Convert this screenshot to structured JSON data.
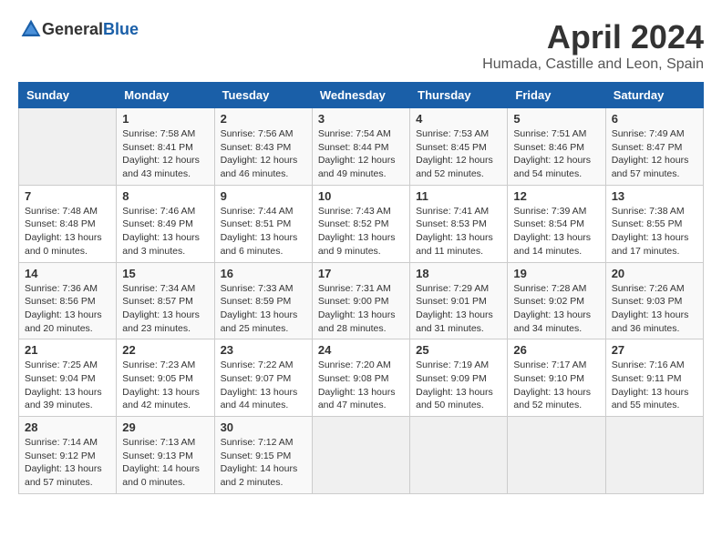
{
  "header": {
    "logo_general": "General",
    "logo_blue": "Blue",
    "title": "April 2024",
    "subtitle": "Humada, Castille and Leon, Spain"
  },
  "calendar": {
    "days_of_week": [
      "Sunday",
      "Monday",
      "Tuesday",
      "Wednesday",
      "Thursday",
      "Friday",
      "Saturday"
    ],
    "weeks": [
      [
        {
          "day": "",
          "info": ""
        },
        {
          "day": "1",
          "info": "Sunrise: 7:58 AM\nSunset: 8:41 PM\nDaylight: 12 hours\nand 43 minutes."
        },
        {
          "day": "2",
          "info": "Sunrise: 7:56 AM\nSunset: 8:43 PM\nDaylight: 12 hours\nand 46 minutes."
        },
        {
          "day": "3",
          "info": "Sunrise: 7:54 AM\nSunset: 8:44 PM\nDaylight: 12 hours\nand 49 minutes."
        },
        {
          "day": "4",
          "info": "Sunrise: 7:53 AM\nSunset: 8:45 PM\nDaylight: 12 hours\nand 52 minutes."
        },
        {
          "day": "5",
          "info": "Sunrise: 7:51 AM\nSunset: 8:46 PM\nDaylight: 12 hours\nand 54 minutes."
        },
        {
          "day": "6",
          "info": "Sunrise: 7:49 AM\nSunset: 8:47 PM\nDaylight: 12 hours\nand 57 minutes."
        }
      ],
      [
        {
          "day": "7",
          "info": "Sunrise: 7:48 AM\nSunset: 8:48 PM\nDaylight: 13 hours\nand 0 minutes."
        },
        {
          "day": "8",
          "info": "Sunrise: 7:46 AM\nSunset: 8:49 PM\nDaylight: 13 hours\nand 3 minutes."
        },
        {
          "day": "9",
          "info": "Sunrise: 7:44 AM\nSunset: 8:51 PM\nDaylight: 13 hours\nand 6 minutes."
        },
        {
          "day": "10",
          "info": "Sunrise: 7:43 AM\nSunset: 8:52 PM\nDaylight: 13 hours\nand 9 minutes."
        },
        {
          "day": "11",
          "info": "Sunrise: 7:41 AM\nSunset: 8:53 PM\nDaylight: 13 hours\nand 11 minutes."
        },
        {
          "day": "12",
          "info": "Sunrise: 7:39 AM\nSunset: 8:54 PM\nDaylight: 13 hours\nand 14 minutes."
        },
        {
          "day": "13",
          "info": "Sunrise: 7:38 AM\nSunset: 8:55 PM\nDaylight: 13 hours\nand 17 minutes."
        }
      ],
      [
        {
          "day": "14",
          "info": "Sunrise: 7:36 AM\nSunset: 8:56 PM\nDaylight: 13 hours\nand 20 minutes."
        },
        {
          "day": "15",
          "info": "Sunrise: 7:34 AM\nSunset: 8:57 PM\nDaylight: 13 hours\nand 23 minutes."
        },
        {
          "day": "16",
          "info": "Sunrise: 7:33 AM\nSunset: 8:59 PM\nDaylight: 13 hours\nand 25 minutes."
        },
        {
          "day": "17",
          "info": "Sunrise: 7:31 AM\nSunset: 9:00 PM\nDaylight: 13 hours\nand 28 minutes."
        },
        {
          "day": "18",
          "info": "Sunrise: 7:29 AM\nSunset: 9:01 PM\nDaylight: 13 hours\nand 31 minutes."
        },
        {
          "day": "19",
          "info": "Sunrise: 7:28 AM\nSunset: 9:02 PM\nDaylight: 13 hours\nand 34 minutes."
        },
        {
          "day": "20",
          "info": "Sunrise: 7:26 AM\nSunset: 9:03 PM\nDaylight: 13 hours\nand 36 minutes."
        }
      ],
      [
        {
          "day": "21",
          "info": "Sunrise: 7:25 AM\nSunset: 9:04 PM\nDaylight: 13 hours\nand 39 minutes."
        },
        {
          "day": "22",
          "info": "Sunrise: 7:23 AM\nSunset: 9:05 PM\nDaylight: 13 hours\nand 42 minutes."
        },
        {
          "day": "23",
          "info": "Sunrise: 7:22 AM\nSunset: 9:07 PM\nDaylight: 13 hours\nand 44 minutes."
        },
        {
          "day": "24",
          "info": "Sunrise: 7:20 AM\nSunset: 9:08 PM\nDaylight: 13 hours\nand 47 minutes."
        },
        {
          "day": "25",
          "info": "Sunrise: 7:19 AM\nSunset: 9:09 PM\nDaylight: 13 hours\nand 50 minutes."
        },
        {
          "day": "26",
          "info": "Sunrise: 7:17 AM\nSunset: 9:10 PM\nDaylight: 13 hours\nand 52 minutes."
        },
        {
          "day": "27",
          "info": "Sunrise: 7:16 AM\nSunset: 9:11 PM\nDaylight: 13 hours\nand 55 minutes."
        }
      ],
      [
        {
          "day": "28",
          "info": "Sunrise: 7:14 AM\nSunset: 9:12 PM\nDaylight: 13 hours\nand 57 minutes."
        },
        {
          "day": "29",
          "info": "Sunrise: 7:13 AM\nSunset: 9:13 PM\nDaylight: 14 hours\nand 0 minutes."
        },
        {
          "day": "30",
          "info": "Sunrise: 7:12 AM\nSunset: 9:15 PM\nDaylight: 14 hours\nand 2 minutes."
        },
        {
          "day": "",
          "info": ""
        },
        {
          "day": "",
          "info": ""
        },
        {
          "day": "",
          "info": ""
        },
        {
          "day": "",
          "info": ""
        }
      ]
    ]
  }
}
